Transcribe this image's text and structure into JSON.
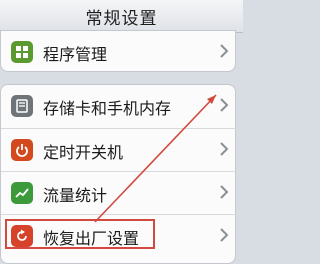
{
  "navbar": {
    "title": "常规设置"
  },
  "items": [
    {
      "label": "程序管理",
      "icon": "apps-grid-icon",
      "color": "#5a9a2e"
    },
    {
      "label": "存储卡和手机内存",
      "icon": "storage-icon",
      "color": "#6f7479"
    },
    {
      "label": "定时开关机",
      "icon": "power-icon",
      "color": "#d24a1d"
    },
    {
      "label": "流量统计",
      "icon": "trend-chart-icon",
      "color": "#3d9a3b"
    },
    {
      "label": "恢复出厂设置",
      "icon": "reset-icon",
      "color": "#d6432a"
    }
  ],
  "annotation": {
    "color": "#d24a3e"
  }
}
